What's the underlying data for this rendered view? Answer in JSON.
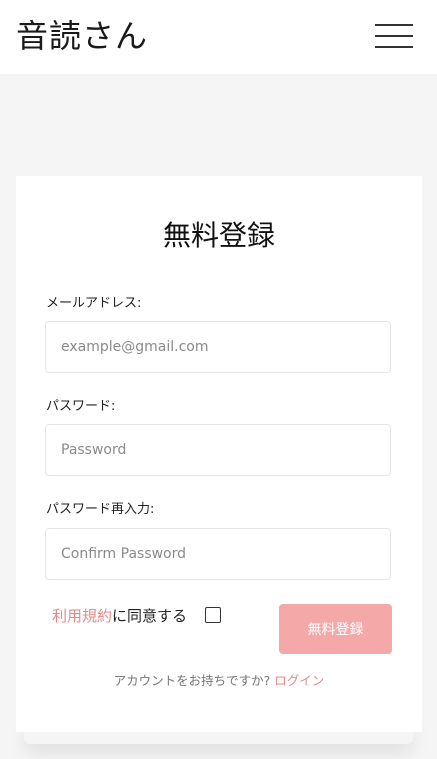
{
  "header": {
    "brand": "音読さん",
    "menu_icon": "hamburger-menu-icon"
  },
  "form": {
    "title": "無料登録",
    "email": {
      "label": "メールアドレス:",
      "placeholder": "example@gmail.com",
      "value": ""
    },
    "password": {
      "label": "パスワード:",
      "placeholder": "Password",
      "value": ""
    },
    "confirm_password": {
      "label": "パスワード再入力:",
      "placeholder": "Confirm Password",
      "value": ""
    },
    "agree": {
      "terms_link": "利用規約",
      "text": "に同意する",
      "checked": false
    },
    "submit_label": "無料登録",
    "footer": {
      "question": "アカウントをお持ちですか?",
      "login_link": "ログイン"
    }
  },
  "colors": {
    "accent": "#e58a8a",
    "button": "#f4a9a8",
    "background": "#f5f5f5"
  }
}
